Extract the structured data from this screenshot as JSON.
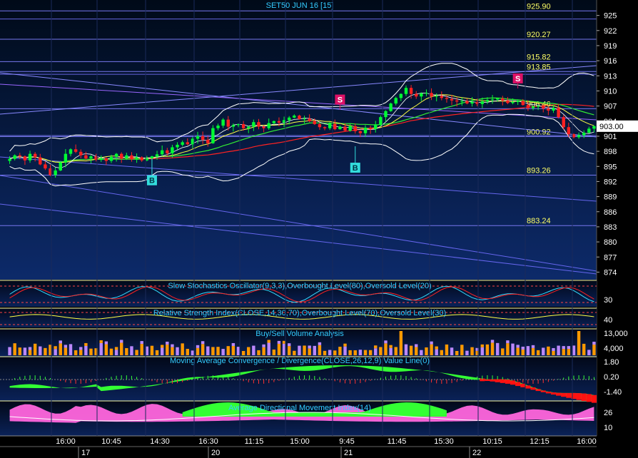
{
  "colors": {
    "bg_top": "#000a18",
    "bg_bottom": "#0d2a6a",
    "panel_bg": "#041030",
    "title": "#33ccff",
    "yellow": "#ffff66",
    "axis_text": "#ffffff",
    "up": "#00ff33",
    "down": "#ff2020",
    "buy": "#33dddd",
    "sell": "#dd1166",
    "orange": "#ff9900",
    "violet": "#bb88ff",
    "pink": "#ff66dd",
    "lime": "#33ff33",
    "red": "#ff1111",
    "white_line": "#ffffff"
  },
  "header": {
    "title": "SET50 JUN 16   [15]"
  },
  "price": {
    "current": "903.00",
    "levels": [
      {
        "value": 925.9,
        "label": "925.90"
      },
      {
        "value": 920.27,
        "label": "920.27"
      },
      {
        "value": 915.82,
        "label": "915.82"
      },
      {
        "value": 913.85,
        "label": "913.85"
      },
      {
        "value": 906.46,
        "label": "906.46"
      },
      {
        "value": 900.92,
        "label": "900.92"
      },
      {
        "value": 893.26,
        "label": "893.26"
      },
      {
        "value": 883.24,
        "label": "883.24"
      }
    ],
    "ticks": [
      "925",
      "922",
      "919",
      "916",
      "913",
      "910",
      "907",
      "904",
      "901",
      "898",
      "895",
      "892",
      "889",
      "886",
      "883",
      "880",
      "877",
      "874"
    ]
  },
  "signals": [
    {
      "type": "B",
      "label": "B",
      "bar": 28,
      "price": 896.5
    },
    {
      "type": "S",
      "label": "S",
      "bar": 65,
      "price": 906.3
    },
    {
      "type": "B",
      "label": "B",
      "bar": 68,
      "price": 899.0
    },
    {
      "type": "S",
      "label": "S",
      "bar": 100,
      "price": 910.5
    }
  ],
  "indicators": {
    "stochastic": {
      "title": "Slow Stochastics Oscillator(9,3,3),Overbought Level(80),Oversold Level(20)",
      "ticks": [
        "30"
      ]
    },
    "rsi": {
      "title": "Relative Strength Index(CLOSE,14,30,70),Overbought Level(70),Oversold Level(30)",
      "ticks": [
        "40"
      ]
    },
    "volume": {
      "title": "Buy/Sell Volume Analysis",
      "ticks": [
        "13,000",
        "4,000"
      ]
    },
    "macd": {
      "title": "Moving Average Convergence / Divergence(CLOSE,26,12,9),Value Line(0)",
      "ticks": [
        "1.80",
        "0.20",
        "-1.40"
      ]
    },
    "adx": {
      "title": "Average Directional Movement Index(14)",
      "ticks": [
        "26",
        "10"
      ]
    }
  },
  "time_axis": {
    "times": [
      "16:00",
      "10:45",
      "14:30",
      "16:30",
      "11:15",
      "15:00",
      "9:45",
      "11:45",
      "15:30",
      "10:15",
      "12:15",
      "16:00"
    ],
    "dates": [
      "17",
      "20",
      "21",
      "22"
    ]
  },
  "chart_data": {
    "type": "line",
    "title": "SET50 JUN 16   [15]",
    "interval": "15",
    "y_range": [
      872.5,
      927.5
    ],
    "close": [
      896.5,
      897.2,
      897.0,
      896.2,
      897.5,
      896.8,
      895.4,
      894.6,
      893.3,
      894.2,
      895.8,
      897.5,
      898.4,
      897.9,
      897.2,
      896.6,
      897.0,
      896.3,
      896.6,
      896.1,
      896.9,
      897.5,
      896.6,
      897.2,
      896.4,
      896.8,
      896.2,
      896.6,
      897.0,
      897.4,
      898.2,
      897.6,
      898.8,
      899.3,
      899.8,
      899.4,
      900.5,
      901.0,
      900.3,
      899.6,
      902.6,
      903.1,
      904.3,
      902.9,
      903.2,
      903.4,
      902.6,
      902.9,
      903.8,
      902.9,
      902.6,
      903.6,
      904.0,
      903.7,
      904.2,
      904.7,
      905.1,
      904.4,
      904.5,
      904.0,
      903.4,
      902.8,
      902.6,
      903.5,
      902.4,
      902.9,
      902.1,
      903.0,
      902.0,
      901.6,
      902.7,
      902.4,
      903.3,
      904.8,
      906.0,
      907.5,
      908.6,
      909.4,
      910.6,
      909.4,
      908.9,
      909.5,
      909.6,
      908.9,
      909.0,
      908.6,
      908.4,
      908.1,
      907.9,
      908.0,
      907.5,
      907.8,
      907.4,
      907.9,
      908.2,
      908.3,
      908.5,
      908.1,
      907.6,
      907.8,
      908.0,
      907.2,
      906.6,
      906.9,
      907.0,
      906.5,
      906.1,
      906.6,
      904.8,
      902.8,
      901.4,
      900.8,
      901.2,
      901.7,
      902.5,
      903.0
    ],
    "levels": [
      925.9,
      920.27,
      915.82,
      913.85,
      906.46,
      900.92,
      893.26,
      883.24
    ],
    "last_price": 903.0
  }
}
